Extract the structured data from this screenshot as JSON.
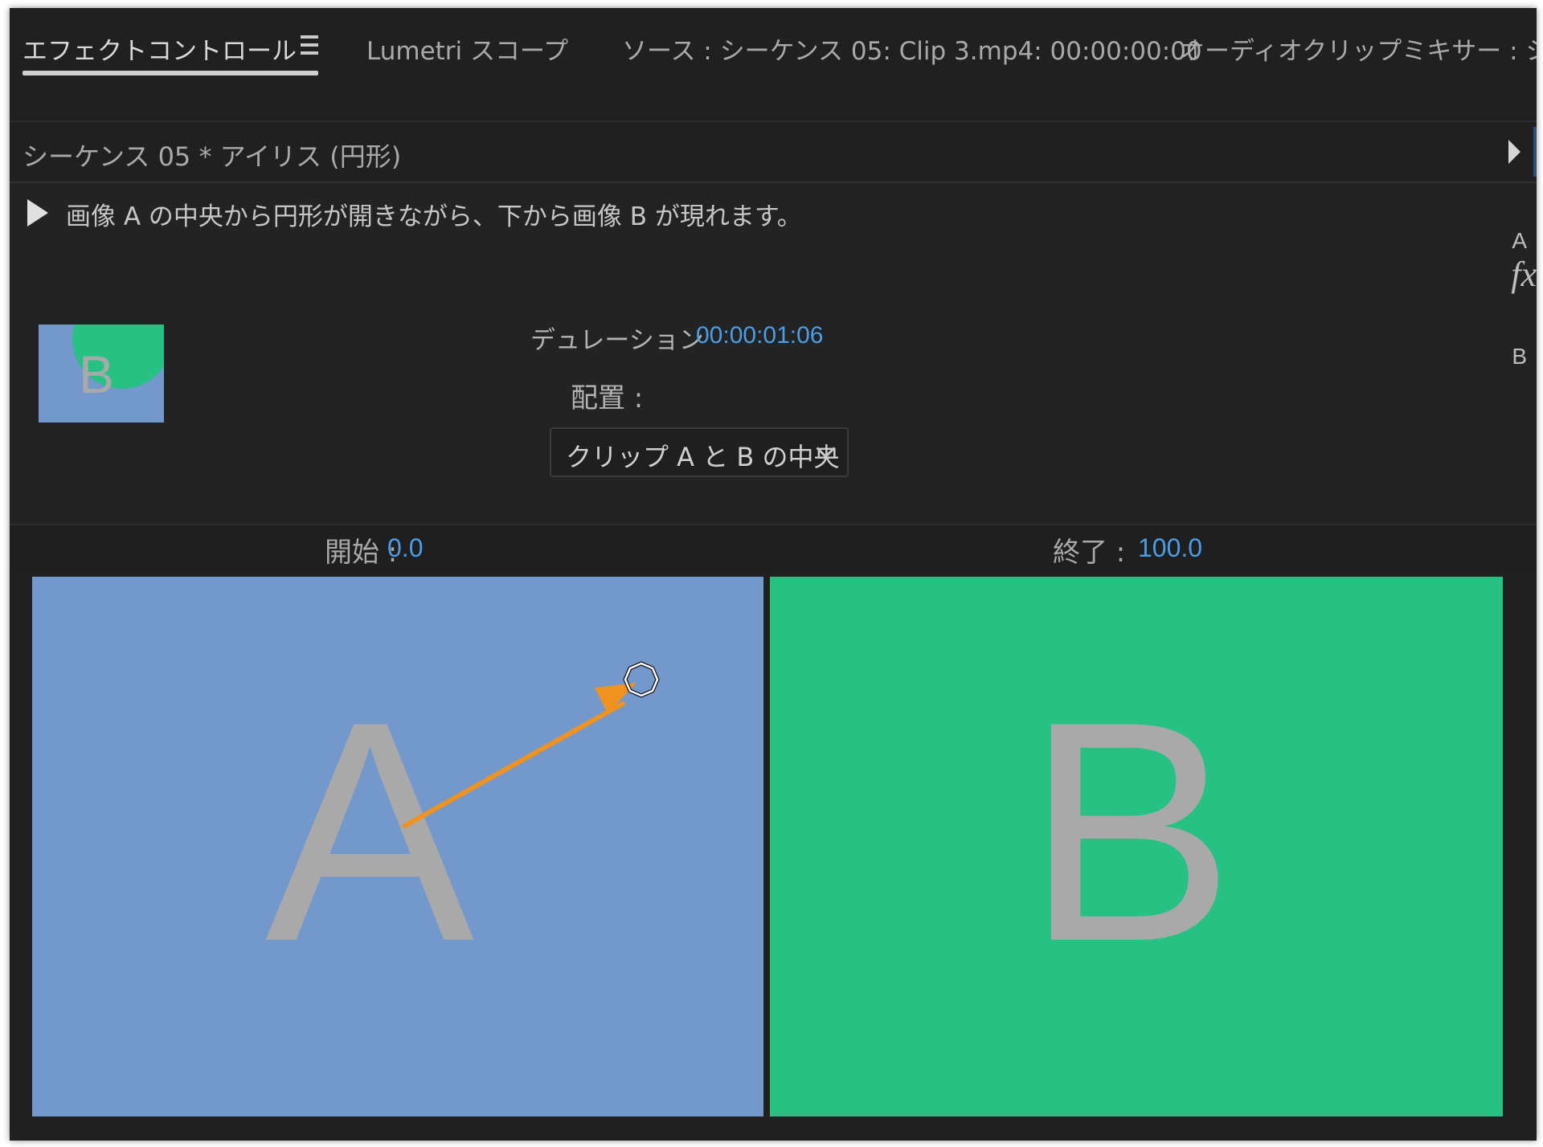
{
  "tabs": [
    {
      "label": "エフェクトコントロール",
      "active": true
    },
    {
      "label": "Lumetri スコープ",
      "active": false
    },
    {
      "label": "ソース : シーケンス 05: Clip 3.mp4: 00:00:00:00",
      "active": false
    },
    {
      "label": "オーディオクリップミキサー : シー",
      "active": false
    }
  ],
  "sequence": {
    "title": "シーケンス 05 * アイリス (円形)"
  },
  "effect": {
    "description": "画像 A の中央から円形が開きながら、下から画像 B が現れます。",
    "thumbnail_letter": "B",
    "duration_label": "デュレーション",
    "duration_value": "00:00:01:06",
    "alignment_label": "配置 :",
    "alignment_value": "クリップ A と B の中央"
  },
  "side": {
    "a": "A",
    "fx": "fx",
    "b": "B"
  },
  "position": {
    "start_label": "開始 :",
    "start_value": "0.0",
    "end_label": "終了 :",
    "end_value": "100.0"
  },
  "preview": {
    "letter_a": "A",
    "letter_b": "B"
  },
  "colors": {
    "panel_bg": "#232323",
    "accent_blue": "#4a9de6",
    "clip_a": "#7298cc",
    "clip_b": "#27c184",
    "annotation_arrow": "#f0921f"
  },
  "icons": [
    "menu-icon",
    "play-icon",
    "expand-arrow-icon",
    "chevron-down-icon",
    "center-handle-icon"
  ]
}
